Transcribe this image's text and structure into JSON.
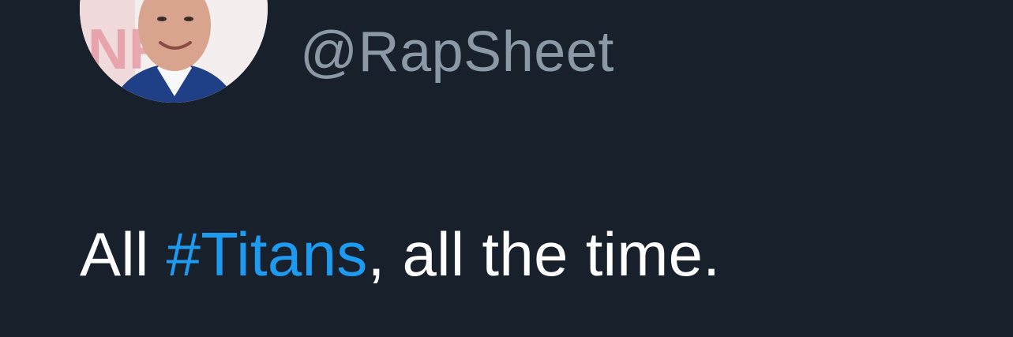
{
  "tweet": {
    "author": {
      "handle": "@RapSheet"
    },
    "text": {
      "before": "All ",
      "hashtag": "#Titans",
      "after": ", all the time."
    }
  },
  "colors": {
    "background": "#17202b",
    "text": "#ffffff",
    "handle": "#8b98a5",
    "hashtag": "#1d9bf0"
  },
  "icons": {
    "avatar": "profile-photo"
  }
}
